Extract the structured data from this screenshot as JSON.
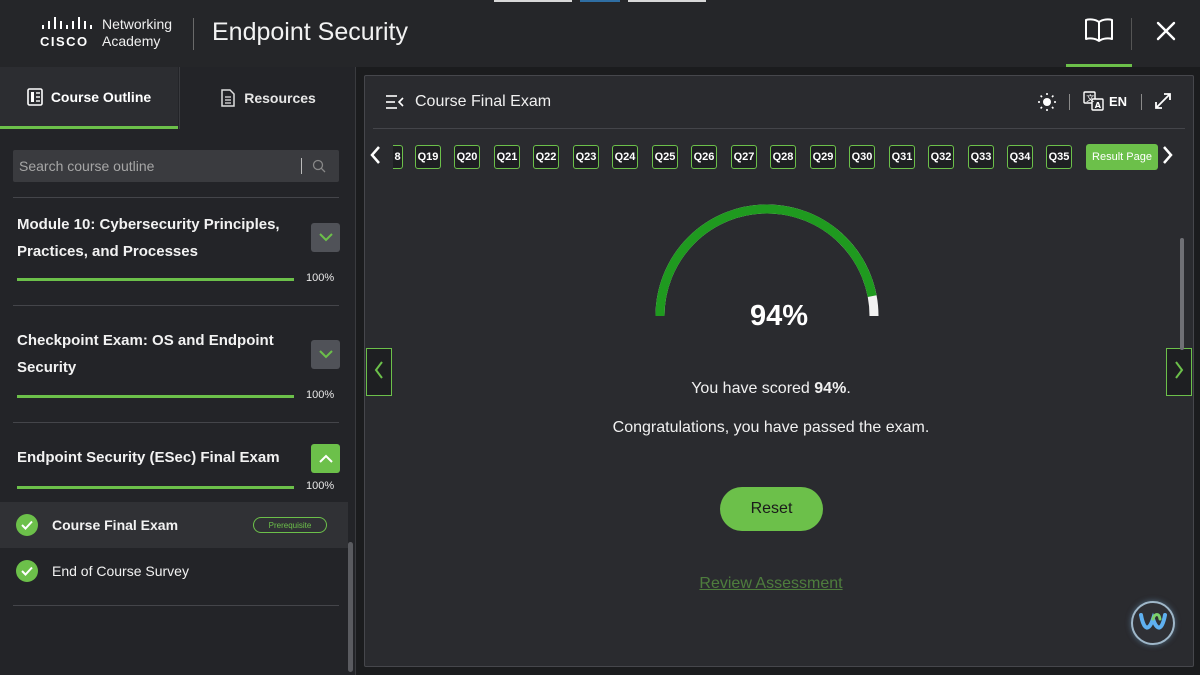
{
  "header": {
    "logo_brand": "CISCO",
    "logo_line1": "Networking",
    "logo_line2": "Academy",
    "title": "Endpoint Security",
    "icons": {
      "book": "book-icon",
      "close": "close-icon"
    }
  },
  "sidebar": {
    "tabs": [
      {
        "label": "Course Outline",
        "icon": "outline-icon",
        "active": true
      },
      {
        "label": "Resources",
        "icon": "document-icon",
        "active": false
      }
    ],
    "search": {
      "placeholder": "Search course outline",
      "icon": "search-icon"
    },
    "modules": [
      {
        "title": "Module 10: Cybersecurity Principles, Practices, and Processes",
        "progress": 100,
        "progress_label": "100%",
        "expanded": false
      },
      {
        "title": "Checkpoint Exam: OS and Endpoint Security",
        "progress": 100,
        "progress_label": "100%",
        "expanded": false
      },
      {
        "title": "Endpoint Security (ESec) Final Exam",
        "progress": 100,
        "progress_label": "100%",
        "expanded": true
      }
    ],
    "subitems": [
      {
        "label": "Course Final Exam",
        "status": "completed",
        "badge": "Prerequisite",
        "active": true
      },
      {
        "label": "End of Course Survey",
        "status": "completed",
        "active": false
      }
    ]
  },
  "main": {
    "title": "Course Final Exam",
    "language": "EN",
    "question_nav": [
      "8",
      "Q19",
      "Q20",
      "Q21",
      "Q22",
      "Q23",
      "Q24",
      "Q25",
      "Q26",
      "Q27",
      "Q28",
      "Q29",
      "Q30",
      "Q31",
      "Q32",
      "Q33",
      "Q34",
      "Q35"
    ],
    "result_button": "Result Page",
    "score_value": 94,
    "score_label": "94%",
    "scored_prefix": "You have scored",
    "scored_value": "94%",
    "scored_suffix": ".",
    "congrats": "Congratulations, you have passed the exam.",
    "reset_label": "Reset",
    "review_label": "Review Assessment"
  },
  "colors": {
    "accent": "#6cc04a",
    "gauge_fill": "#1f9a1f",
    "background": "#1b1c1e",
    "panel": "#2a2b2f"
  }
}
